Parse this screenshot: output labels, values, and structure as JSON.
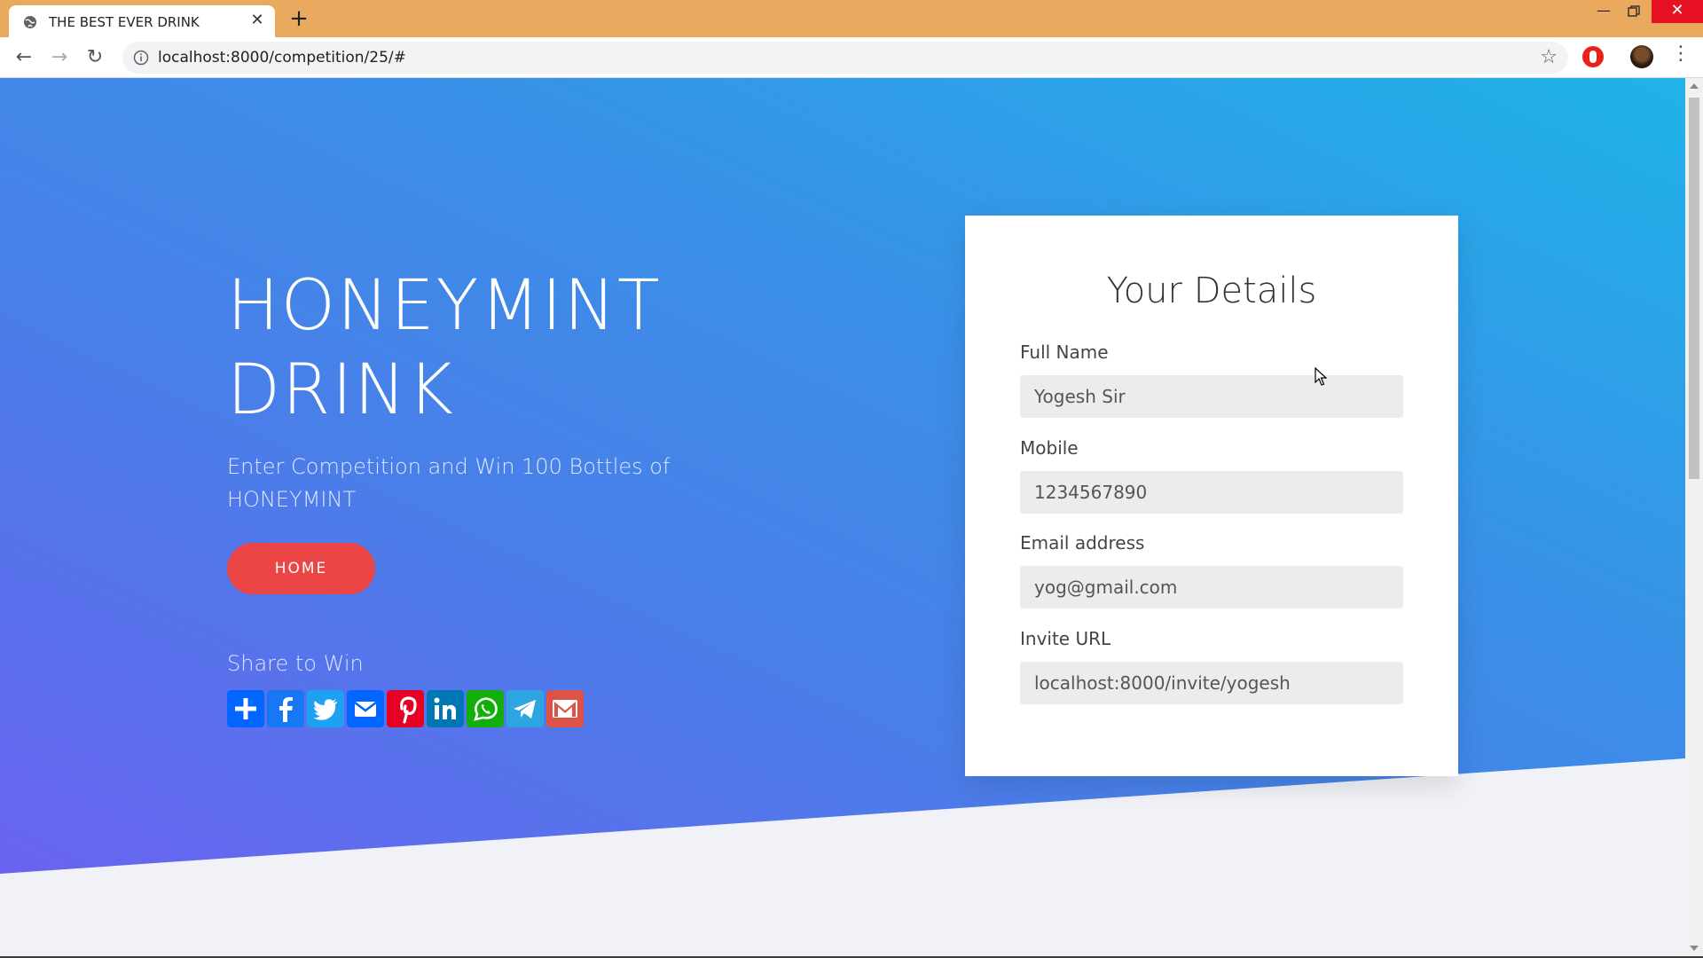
{
  "browser": {
    "tab_title": "THE BEST EVER DRINK",
    "tab_close": "✕",
    "new_tab": "+",
    "url": "localhost:8000/competition/25/#",
    "window_min": "—",
    "window_close": "✕"
  },
  "hero": {
    "title": "HONEYMINT DRINK",
    "subtitle": "Enter Competition and Win 100 Bottles of HONEYMINT",
    "home_button": "HOME",
    "share_title": "Share to Win",
    "share_icons": [
      {
        "name": "addtoany-icon",
        "color": "#0166ff"
      },
      {
        "name": "facebook-icon",
        "color": "#1877f2"
      },
      {
        "name": "twitter-icon",
        "color": "#1da1f2"
      },
      {
        "name": "email-icon",
        "color": "#0166ff"
      },
      {
        "name": "pinterest-icon",
        "color": "#e60023"
      },
      {
        "name": "linkedin-icon",
        "color": "#0077b5"
      },
      {
        "name": "whatsapp-icon",
        "color": "#12af0a"
      },
      {
        "name": "telegram-icon",
        "color": "#2ca5e0"
      },
      {
        "name": "gmail-icon",
        "color": "#dd5347"
      }
    ]
  },
  "form": {
    "title": "Your Details",
    "full_name_label": "Full Name",
    "full_name_value": "Yogesh Sir",
    "mobile_label": "Mobile",
    "mobile_value": "1234567890",
    "email_label": "Email address",
    "email_value": "yog@gmail.com",
    "invite_label": "Invite URL",
    "invite_value": "localhost:8000/invite/yogesh"
  },
  "colors": {
    "tabbar": "#e9a95f",
    "home_button": "#eb4545",
    "hero_gradient_start": "#6a63f0",
    "hero_gradient_end": "#1fb3e8"
  }
}
